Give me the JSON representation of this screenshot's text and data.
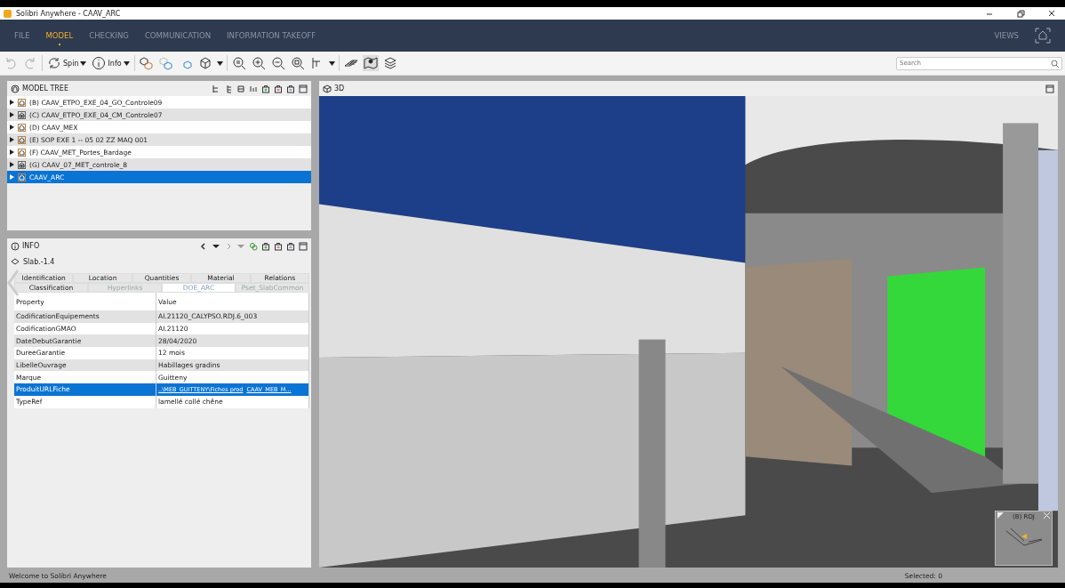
{
  "window": {
    "title": "Solibri Anywhere - CAAV_ARC"
  },
  "menu_tabs": [
    {
      "label": "FILE",
      "selected": false
    },
    {
      "label": "MODEL",
      "selected": true
    },
    {
      "label": "CHECKING",
      "selected": false
    },
    {
      "label": "COMMUNICATION",
      "selected": false
    },
    {
      "label": "INFORMATION TAKEOFF",
      "selected": false
    }
  ],
  "views_label": "VIEWS",
  "toolbar": {
    "spin_label": "Spin",
    "info_label": "Info",
    "search": {
      "placeholder": "Search"
    }
  },
  "model_tree": {
    "title": "MODEL TREE",
    "items": [
      {
        "label": "(B) CAAV_ETPO_EXE_04_GO_Controle09",
        "kind": "house",
        "selected": false
      },
      {
        "label": "(C) CAAV_ETPO_EXE_04_CM_Controle07",
        "kind": "grid",
        "selected": false
      },
      {
        "label": "(D) CAAV_MEX",
        "kind": "house",
        "selected": false
      },
      {
        "label": "(E) SOP EXE 1 -- 05 02 ZZ MAQ 001",
        "kind": "house",
        "selected": false
      },
      {
        "label": "(F) CAAV_MET_Portes_Bardage",
        "kind": "house",
        "selected": false
      },
      {
        "label": "(G) CAAV_07_MET_controle_8",
        "kind": "grid",
        "selected": false
      },
      {
        "label": "CAAV_ARC",
        "kind": "house",
        "selected": true
      }
    ]
  },
  "info": {
    "title": "INFO",
    "object": "Slab.-1.4",
    "tab_rows": [
      [
        {
          "label": "Identification",
          "selected": false
        },
        {
          "label": "Location",
          "selected": false
        },
        {
          "label": "Quantities",
          "selected": false
        },
        {
          "label": "Material",
          "selected": false
        },
        {
          "label": "Relations",
          "selected": false
        }
      ],
      [
        {
          "label": "Classification",
          "selected": false
        },
        {
          "label": "Hyperlinks",
          "selected": false
        },
        {
          "label": "DOE_ARC",
          "selected": true
        },
        {
          "label": "Pset_SlabCommon",
          "selected": false
        }
      ]
    ],
    "columns": [
      "Property",
      "Value"
    ],
    "rows": [
      {
        "property": "CodificationEquipements",
        "value": "AI.21120_CALYPSO.RDJ.6_003",
        "selected": false
      },
      {
        "property": "CodificationGMAO",
        "value": "AI.21120",
        "selected": false
      },
      {
        "property": "DateDebutGarantie",
        "value": "28/04/2020",
        "selected": false
      },
      {
        "property": "DureeGarantie",
        "value": "12 mois",
        "selected": false
      },
      {
        "property": "LibelleOuvrage",
        "value": "Habillages gradins",
        "selected": false
      },
      {
        "property": "Marque",
        "value": "Guitteny",
        "selected": false
      },
      {
        "property": "ProduitURLFiche",
        "value": "..\\MEB_GUITTENY\\Fiches prod",
        "value_end": "CAAV_MEB_M...",
        "selected": true
      },
      {
        "property": "TypeRef",
        "value": "lamellé collé chêne",
        "selected": false
      }
    ]
  },
  "view3d": {
    "title": "3D",
    "minimap_title": "(B) RDJ"
  },
  "status_bar": {
    "message": "Welcome to Solibri Anywhere",
    "selection": "Selected: 0"
  }
}
